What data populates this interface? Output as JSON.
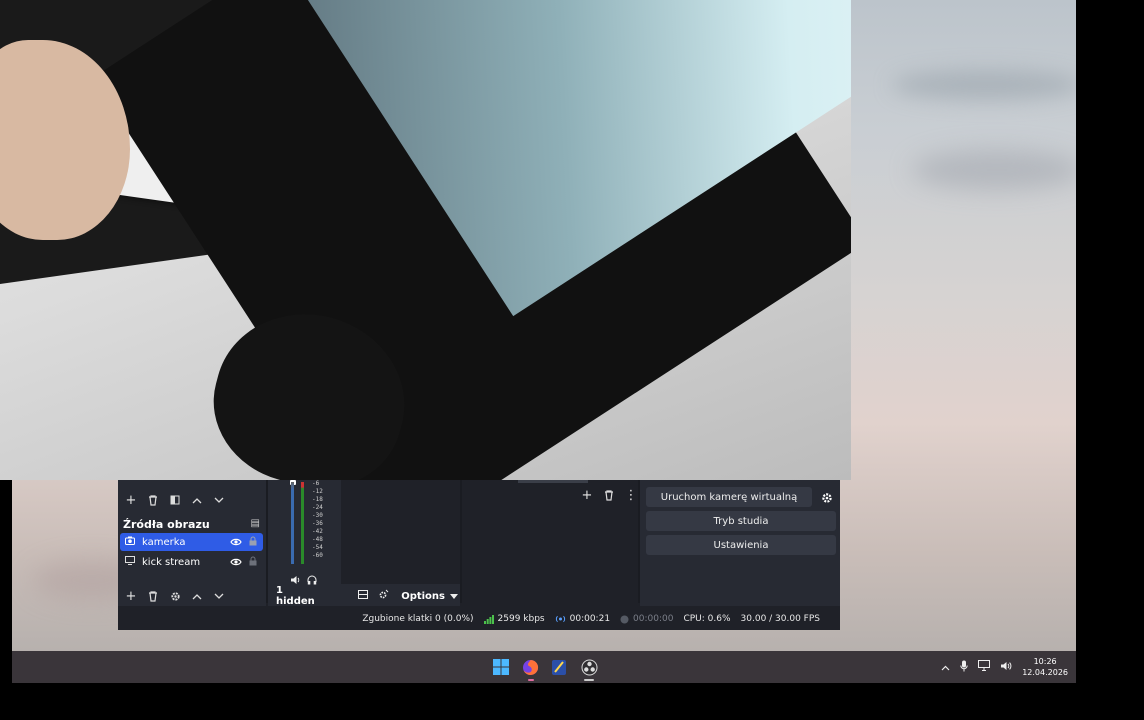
{
  "obs": {
    "sources": {
      "title": "Źródła obrazu",
      "items": [
        {
          "label": "kamerka",
          "icon": "camera-icon",
          "selected": true
        },
        {
          "label": "kick stream",
          "icon": "monitor-icon",
          "selected": false
        }
      ]
    },
    "mixer": {
      "ticks": [
        "-6",
        "-12",
        "-18",
        "-24",
        "-30",
        "-36",
        "-42",
        "-48",
        "-54",
        "-60"
      ],
      "hidden_label": "1 hidden",
      "options_label": "Options"
    },
    "controls": {
      "virtual_camera": "Uruchom kamerę wirtualną",
      "studio_mode": "Tryb studia",
      "settings": "Ustawienia"
    },
    "status": {
      "dropped_frames": "Zgubione klatki 0 (0.0%)",
      "bitrate": "2599 kbps",
      "stream_time": "00:00:21",
      "record_time": "00:00:00",
      "cpu": "CPU: 0.6%",
      "fps": "30.00 / 30.00 FPS"
    },
    "colors": {
      "accent": "#2f5ce6",
      "stream_active": "#5aa0ff",
      "bitrate_good": "#4cc04c"
    }
  },
  "taskbar": {
    "apps": [
      "windows-start-icon",
      "firefox-icon",
      "notepad-icon",
      "obs-icon"
    ],
    "tray_icons": [
      "chevron-up-icon",
      "microphone-icon",
      "network-icon",
      "speaker-icon"
    ],
    "time": "10:26",
    "date": "12.04.2026"
  }
}
